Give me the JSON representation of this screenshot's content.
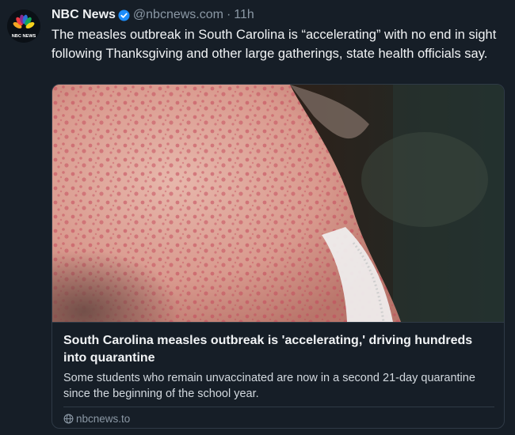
{
  "author": {
    "display_name": "NBC News",
    "handle": "@nbcnews.com",
    "separator": "·",
    "time": "11h",
    "avatar_text": "NBC NEWS",
    "verified": true
  },
  "post": {
    "text": "The measles outbreak in South Carolina is “accelerating” with no end in sight following Thanksgiving and other large gatherings, state health officials say."
  },
  "link_card": {
    "title": "South Carolina measles outbreak is 'accelerating,' driving hundreds into quarantine",
    "description": "Some students who remain unvaccinated are now in a second 21-day quarantine since the beginning of the school year.",
    "domain": "nbcnews.to",
    "image_icon": "photo-neck-rash"
  },
  "colors": {
    "background": "#161e27",
    "text": "#f1f3f5",
    "muted": "#8b98a5",
    "border": "#2f3a46",
    "verified_blue": "#1d8cf8"
  }
}
